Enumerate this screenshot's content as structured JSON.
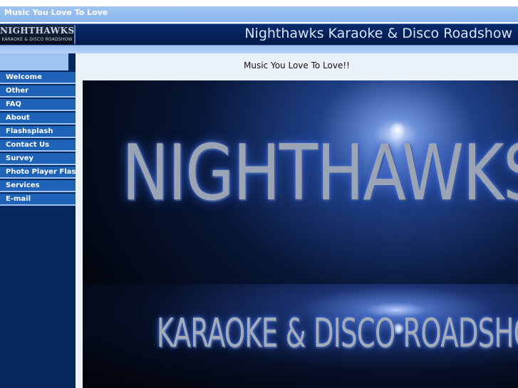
{
  "topbar": {
    "text": "Music You Love To Love"
  },
  "header": {
    "logo_main": "NIGHTHAWKS",
    "logo_sub": "KARAOKE & DISCO ROADSHOW",
    "site_title": "Nighthawks Karaoke & Disco Roadshow"
  },
  "nav": {
    "items": [
      {
        "label": "Welcome"
      },
      {
        "label": "Other"
      },
      {
        "label": "FAQ"
      },
      {
        "label": "About"
      },
      {
        "label": "Flashsplash"
      },
      {
        "label": "Contact Us"
      },
      {
        "label": "Survey"
      },
      {
        "label": "Photo Player Flash"
      },
      {
        "label": "Services"
      },
      {
        "label": "E-mail"
      }
    ]
  },
  "main": {
    "tagline": "Music You Love To Love!!",
    "banner_title": "NIGHTHAWKS",
    "banner_subtitle": "KARAOKE & DISCO ROADSHOW"
  },
  "colors": {
    "light_blue": "#9fc4f0",
    "header_navy": "#0a2b6c",
    "nav_item_blue": "#1e63b8",
    "sidebar_navy": "#07275f",
    "content_bg": "#ebf1f9"
  }
}
